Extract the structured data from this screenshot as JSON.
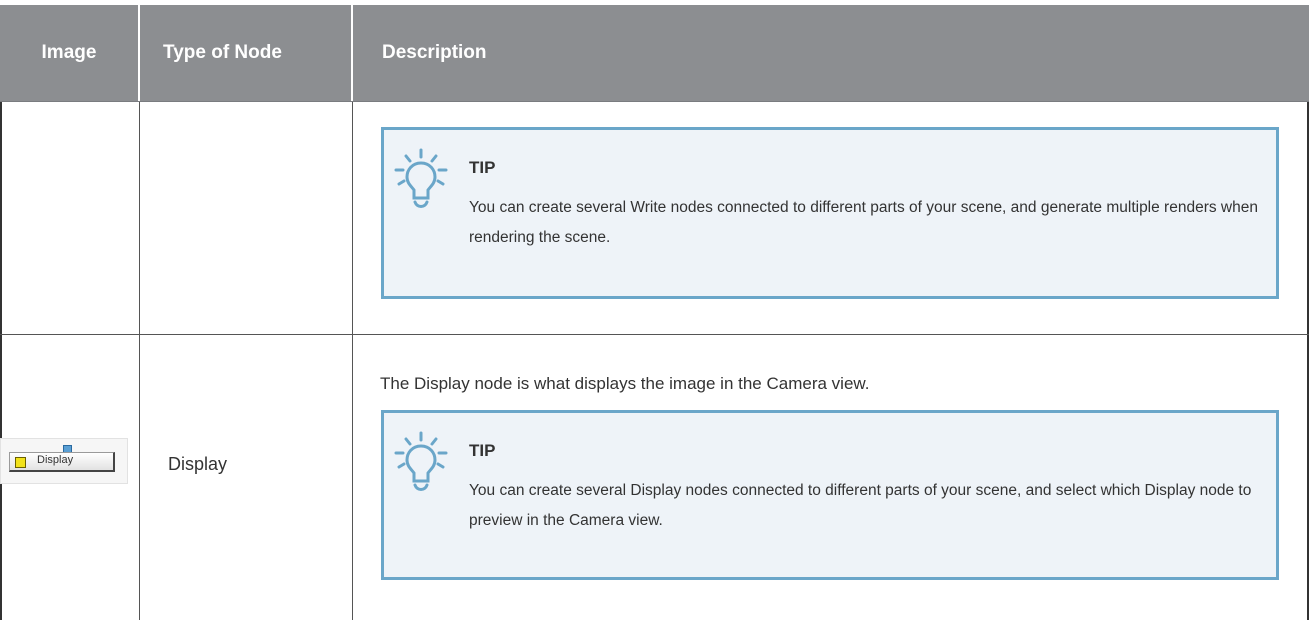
{
  "table": {
    "headers": {
      "image": "Image",
      "type": "Type of Node",
      "description": "Description"
    },
    "rows": [
      {
        "type": "",
        "description": "",
        "tip": {
          "title": "TIP",
          "text": "You can create several Write nodes connected to different parts of your scene, and generate multiple renders when rendering the scene."
        }
      },
      {
        "node_label": "Display",
        "type": "Display",
        "description": "The Display node is what displays the image in the Camera view.",
        "tip": {
          "title": "TIP",
          "text": "You can create several Display nodes connected to different parts of your scene, and select which Display node to preview in the Camera view."
        }
      }
    ]
  },
  "icons": {
    "tip": "lightbulb-icon"
  },
  "colors": {
    "header_bg": "#8c8e91",
    "tip_border": "#6aa6c9",
    "tip_bg": "#eef3f8"
  }
}
